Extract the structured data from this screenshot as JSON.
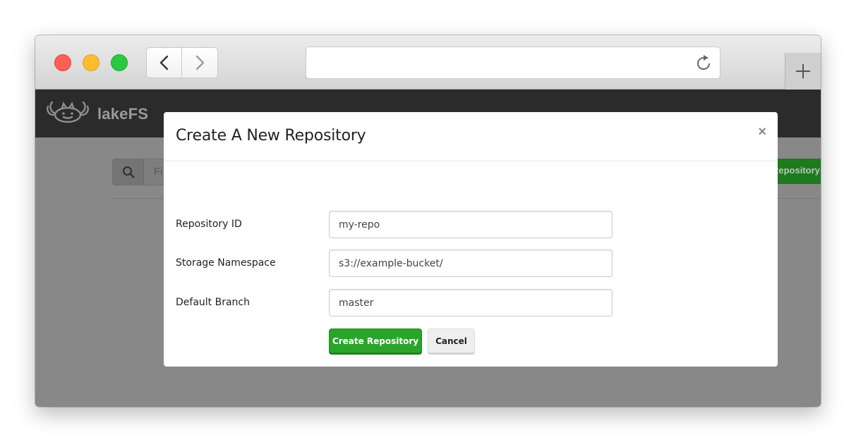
{
  "browser": {
    "url": "",
    "icons": {
      "back": "chevron-left-icon",
      "forward": "chevron-right-icon",
      "reload": "reload-icon",
      "new_tab": "plus-icon"
    }
  },
  "app": {
    "brand": "lakeFS",
    "search_placeholder": "Fi",
    "new_repo_button": "Repository"
  },
  "modal": {
    "title": "Create A New Repository",
    "close_label": "×",
    "fields": [
      {
        "label": "Repository ID",
        "value": "my-repo"
      },
      {
        "label": "Storage Namespace",
        "value": "s3://example-bucket/"
      },
      {
        "label": "Default Branch",
        "value": "master"
      }
    ],
    "create_label": "Create Repository",
    "cancel_label": "Cancel"
  },
  "colors": {
    "primary_green": "#2aa52a",
    "navbar": "#2b2b2b",
    "overlay": "#888888"
  }
}
